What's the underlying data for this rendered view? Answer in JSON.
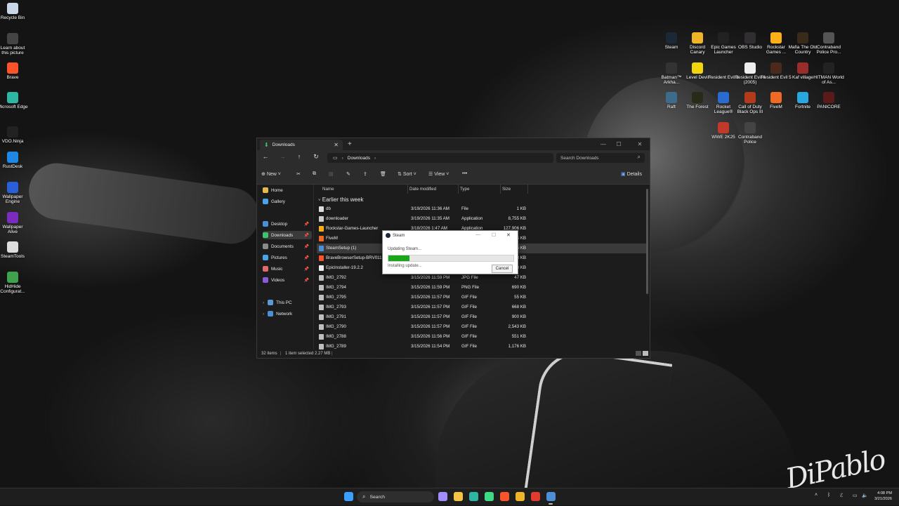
{
  "desktop": {
    "left_icons": [
      {
        "label": "Recycle Bin",
        "icon": "recycle-bin-icon",
        "color": "#c8d6e5"
      },
      {
        "label": "Learn about this picture",
        "icon": "info-icon",
        "color": "#444444"
      },
      {
        "label": "Brave",
        "icon": "brave-icon",
        "color": "#fb542b"
      },
      {
        "label": "Microsoft Edge",
        "icon": "edge-icon",
        "color": "#2fb5a3"
      },
      {
        "label": "VDO.Ninja",
        "icon": "vdo-ninja-icon",
        "color": "#222222"
      },
      {
        "label": "RustDesk",
        "icon": "rustdesk-icon",
        "color": "#1e88e5"
      },
      {
        "label": "Wallpaper Engine",
        "icon": "wallpaper-engine-icon",
        "color": "#2b5fd9"
      },
      {
        "label": "Wallpaper Alive",
        "icon": "wallpaper-alive-icon",
        "color": "#7b2cbf"
      },
      {
        "label": "SteamTools",
        "icon": "steamtools-icon",
        "color": "#dddddd"
      },
      {
        "label": "HidHide Configurat...",
        "icon": "hidhide-icon",
        "color": "#3fa34d"
      }
    ],
    "right_icons": [
      {
        "label": "Steam",
        "icon": "steam-icon",
        "color": "#1b2838"
      },
      {
        "label": "Discord Canary",
        "icon": "discord-icon",
        "color": "#f0b429"
      },
      {
        "label": "Epic Games Launcher",
        "icon": "epic-games-icon",
        "color": "#222222"
      },
      {
        "label": "OBS Studio",
        "icon": "obs-icon",
        "color": "#302e31"
      },
      {
        "label": "Rockstar Games ...",
        "icon": "rockstar-icon",
        "color": "#fcaf17"
      },
      {
        "label": "Mafia The Old Country",
        "icon": "mafia-icon",
        "color": "#3a2a1a"
      },
      {
        "label": "Contraband Police Pro...",
        "icon": "contraband-icon",
        "color": "#555555"
      },
      {
        "label": "Batman™ Arkha...",
        "icon": "batman-icon",
        "color": "#333333"
      },
      {
        "label": "Level Devil",
        "icon": "level-devil-icon",
        "color": "#f2d60d"
      },
      {
        "label": "Resident Evil 3",
        "icon": "re3-icon",
        "color": "#222222"
      },
      {
        "label": "Resident Evil 4 (2005)",
        "icon": "re4-icon",
        "color": "#eeeeee"
      },
      {
        "label": "Resident Evil 5",
        "icon": "re5-icon",
        "color": "#4a2a1a"
      },
      {
        "label": "Kaf village",
        "icon": "kaf-village-icon",
        "color": "#9b2c2c"
      },
      {
        "label": "HITMAN World of As...",
        "icon": "hitman-icon",
        "color": "#222222"
      },
      {
        "label": "Raft",
        "icon": "raft-icon",
        "color": "#3d6b8c"
      },
      {
        "label": "The Forest",
        "icon": "the-forest-icon",
        "color": "#2a2a1a"
      },
      {
        "label": "Rocket League®",
        "icon": "rocket-league-icon",
        "color": "#2a6bd1"
      },
      {
        "label": "Call of Duty Black Ops III",
        "icon": "cod-icon",
        "color": "#b33a1a"
      },
      {
        "label": "FiveM",
        "icon": "fivem-icon",
        "color": "#f06a24"
      },
      {
        "label": "Fortnite",
        "icon": "fortnite-icon",
        "color": "#29a8e0"
      },
      {
        "label": "PANICORE",
        "icon": "panicore-icon",
        "color": "#5a1a1a"
      },
      {
        "label": "WWE 2K25",
        "icon": "wwe-icon",
        "color": "#c0392b"
      },
      {
        "label": "Contraband Police",
        "icon": "contraband-police-icon",
        "color": "#444444"
      }
    ]
  },
  "explorer": {
    "tab_title": "Downloads",
    "new_tab": "+",
    "path_location": "Downloads",
    "search_placeholder": "Search Downloads",
    "toolbar": {
      "new": "New",
      "sort": "Sort",
      "view": "View",
      "more": "•••",
      "details": "Details"
    },
    "nav": {
      "home": "Home",
      "gallery": "Gallery",
      "quick": [
        "Desktop",
        "Downloads",
        "Documents",
        "Pictures",
        "Music",
        "Videos"
      ],
      "this_pc": "This PC",
      "network": "Network"
    },
    "columns": {
      "name": "Name",
      "date": "Date modified",
      "type": "Type",
      "size": "Size"
    },
    "group_label": "Earlier this week",
    "files": [
      {
        "name": "db",
        "date": "3/19/2026 11:36 AM",
        "type": "File",
        "size": "1 KB",
        "icon": "file-icon"
      },
      {
        "name": "downloader",
        "date": "3/19/2026 11:35 AM",
        "type": "Application",
        "size": "8,755 KB",
        "icon": "app-icon"
      },
      {
        "name": "Rockstar-Games-Launcher",
        "date": "3/18/2026 1:47 AM",
        "type": "Application",
        "size": "127,906 KB",
        "icon": "rockstar-icon"
      },
      {
        "name": "FiveM",
        "date": "",
        "type": "",
        "size": "4 KB",
        "icon": "fivem-icon"
      },
      {
        "name": "SteamSetup (1)",
        "date": "",
        "type": "",
        "size": "5 KB",
        "icon": "steam-icon"
      },
      {
        "name": "BraveBrowserSetup-BRV011",
        "date": "",
        "type": "",
        "size": "8 KB",
        "icon": "brave-icon"
      },
      {
        "name": "EpicInstaller-19.2.2",
        "date": "",
        "type": "",
        "size": "8 KB",
        "icon": "epic-games-icon"
      },
      {
        "name": "IMG_2792",
        "date": "3/15/2026 11:59 PM",
        "type": "JPG File",
        "size": "47 KB",
        "icon": "image-icon"
      },
      {
        "name": "IMG_2794",
        "date": "3/15/2026 11:59 PM",
        "type": "PNG File",
        "size": "690 KB",
        "icon": "image-icon"
      },
      {
        "name": "IMG_2795",
        "date": "3/15/2026 11:57 PM",
        "type": "GIF File",
        "size": "55 KB",
        "icon": "image-icon"
      },
      {
        "name": "IMG_2793",
        "date": "3/15/2026 11:57 PM",
        "type": "GIF File",
        "size": "668 KB",
        "icon": "image-icon"
      },
      {
        "name": "IMG_2791",
        "date": "3/15/2026 11:57 PM",
        "type": "GIF File",
        "size": "900 KB",
        "icon": "image-icon"
      },
      {
        "name": "IMG_2790",
        "date": "3/15/2026 11:57 PM",
        "type": "GIF File",
        "size": "2,543 KB",
        "icon": "image-icon"
      },
      {
        "name": "IMG_2788",
        "date": "3/15/2026 11:56 PM",
        "type": "GIF File",
        "size": "551 KB",
        "icon": "image-icon"
      },
      {
        "name": "IMG_2789",
        "date": "3/15/2026 11:54 PM",
        "type": "GIF File",
        "size": "1,176 KB",
        "icon": "image-icon"
      }
    ],
    "selected_index": 4,
    "status": {
      "count": "32 items",
      "selection": "1 item selected  2.27 MB"
    }
  },
  "steam_dialog": {
    "title": "Steam",
    "message": "Updating Steam...",
    "progress": 0.17,
    "status": "Installing update...",
    "cancel": "Cancel",
    "accent": "#1aa51a"
  },
  "taskbar": {
    "search_label": "Search",
    "apps": [
      {
        "icon": "windows-start-icon",
        "color": "#3aa0ff"
      },
      {
        "icon": "widgets-icon",
        "color": "#a48cff"
      },
      {
        "icon": "file-explorer-icon",
        "color": "#f4c542"
      },
      {
        "icon": "edge-icon",
        "color": "#2fb5a3"
      },
      {
        "icon": "android-studio-icon",
        "color": "#3ddc84"
      },
      {
        "icon": "brave-icon",
        "color": "#fb542b"
      },
      {
        "icon": "discord-canary-icon",
        "color": "#f0b429"
      },
      {
        "icon": "chrome-icon",
        "color": "#e33b2e"
      },
      {
        "icon": "steam-icon",
        "color": "#4c8fd6"
      }
    ],
    "time": "4:08 PM",
    "date": "3/21/2026"
  },
  "signature_text": "DiPablo"
}
